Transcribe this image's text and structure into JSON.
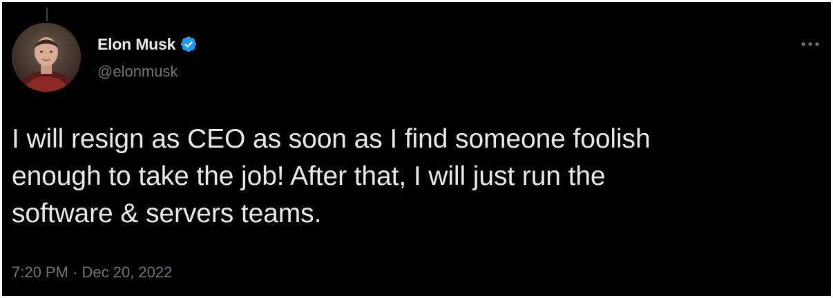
{
  "author": {
    "display_name": "Elon Musk",
    "handle": "@elonmusk",
    "verified": true,
    "verified_icon": "verified-badge-icon",
    "verified_color": "#1d9bf0"
  },
  "tweet": {
    "text": "I will resign as CEO as soon as I find someone foolish\nenough to take the job! After that, I will just run the\nsoftware & servers teams.",
    "time": "7:20 PM",
    "separator": "·",
    "date": "Dec 20, 2022"
  },
  "menu": {
    "icon": "more-icon"
  },
  "colors": {
    "background": "#000000",
    "text_primary": "#e7e9ea",
    "text_secondary": "#71767b"
  }
}
